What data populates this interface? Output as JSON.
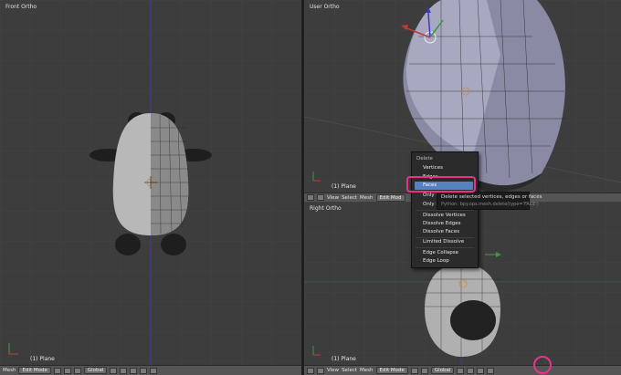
{
  "viewports": {
    "front": {
      "label": "Front Ortho",
      "object": "(1) Plane"
    },
    "user": {
      "label": "User Ortho",
      "object": "(1) Plane"
    },
    "right": {
      "label": "Right Ortho",
      "object": "(1) Plane"
    }
  },
  "header_left": {
    "mesh": "Mesh",
    "mode": "Edit Mode",
    "orientation": "Global"
  },
  "header_user": {
    "view": "View",
    "select": "Select",
    "mesh": "Mesh",
    "mode": "Edit Mod"
  },
  "header_right": {
    "view": "View",
    "select": "Select",
    "mesh": "Mesh",
    "mode": "Edit Mode",
    "orientation": "Global"
  },
  "delete_menu": {
    "title": "Delete",
    "items": [
      "Vertices",
      "Edges",
      "Faces",
      "Only E",
      "Only F",
      "Dissolve Vertices",
      "Dissolve Edges",
      "Dissolve Faces",
      "Limited Dissolve",
      "Edge Collapse",
      "Edge Loop"
    ],
    "highlighted": "Faces"
  },
  "tooltip": {
    "description": "Delete selected vertices, edges or faces",
    "python": "Python: bpy.ops.mesh.delete(type='FACE')"
  },
  "colors": {
    "accent_highlight": "#5680c2",
    "callout": "#e5348a",
    "background": "#3d3d3d"
  }
}
